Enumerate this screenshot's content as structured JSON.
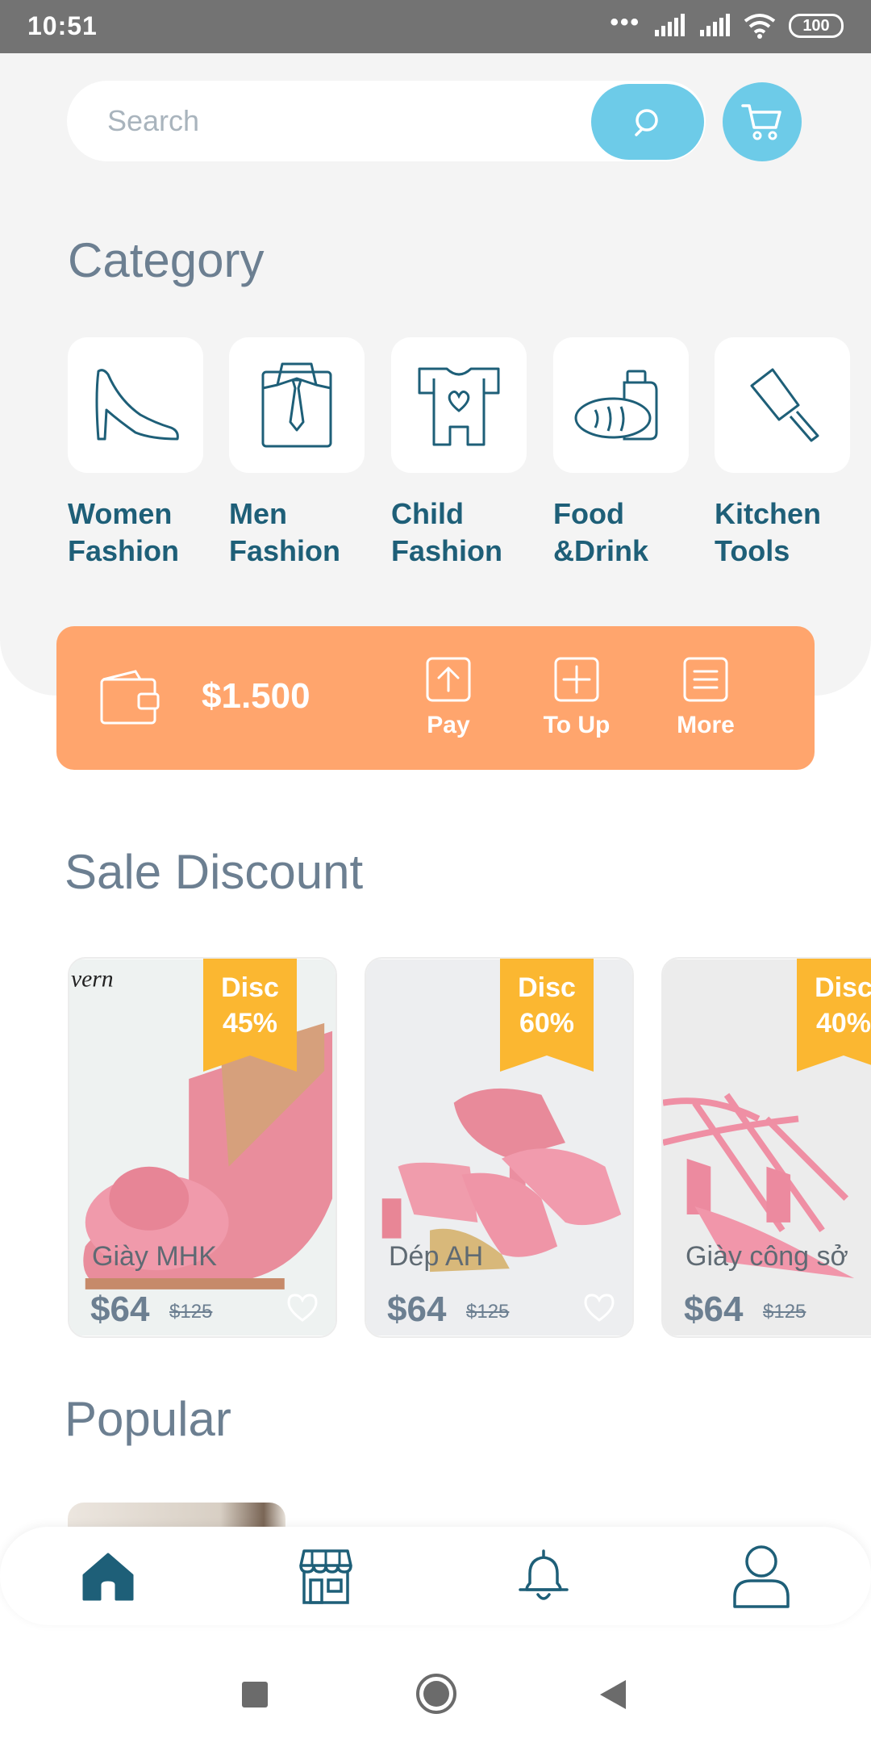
{
  "status_bar": {
    "time": "10:51",
    "battery": "100"
  },
  "search": {
    "placeholder": "Search"
  },
  "category": {
    "title": "Category",
    "items": [
      {
        "label": "Women\nFashion",
        "icon": "high-heel-icon"
      },
      {
        "label": "Men\nFashion",
        "icon": "shirt-tie-icon"
      },
      {
        "label": "Child\nFashion",
        "icon": "baby-onesie-icon"
      },
      {
        "label": "Food\n&Drink",
        "icon": "bread-bottle-icon"
      },
      {
        "label": "Kitchen\nTools",
        "icon": "cleaver-icon"
      }
    ]
  },
  "wallet": {
    "balance": "$1.500",
    "actions": [
      {
        "label": "Pay",
        "icon": "upload-arrow-icon"
      },
      {
        "label": "To Up",
        "icon": "plus-square-icon"
      },
      {
        "label": "More",
        "icon": "menu-lines-icon"
      }
    ]
  },
  "sale": {
    "title": "Sale Discount",
    "products": [
      {
        "name": "Giày MHK",
        "price": "$64",
        "old_price": "$125",
        "badge": "Disc\n45%"
      },
      {
        "name": "Dép AH",
        "price": "$64",
        "old_price": "$125",
        "badge": "Disc\n60%"
      },
      {
        "name": "Giày công sở",
        "price": "$64",
        "old_price": "$125",
        "badge": "Disc\n40%"
      }
    ]
  },
  "popular": {
    "title": "Popular"
  },
  "bottom_nav": [
    "home-icon",
    "store-icon",
    "bell-icon",
    "profile-icon"
  ],
  "colors": {
    "accent": "#6dcbe8",
    "wallet": "#ffa56d",
    "badge": "#fbb731",
    "primary_text": "#1e5f78",
    "muted_text": "#6c7f91"
  }
}
